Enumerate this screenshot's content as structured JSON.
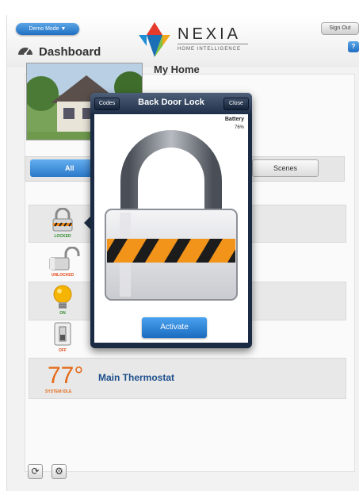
{
  "header": {
    "demo_mode_label": "Demo Mode ▼",
    "page_title": "Dashboard",
    "logo_name": "NEXIA",
    "logo_tagline": "HOME INTELLIGENCE",
    "sign_out_label": "Sign Out",
    "help_label": "?"
  },
  "home": {
    "title": "My Home"
  },
  "tabs": {
    "all_devices_label": "All Devices",
    "scenes_label": "Scenes"
  },
  "devices": [
    {
      "status": "LOCKED",
      "status_color": "#2d8a2d",
      "icon": "padlock-locked-icon"
    },
    {
      "status": "UNLOCKED",
      "status_color": "#e24a1a",
      "icon": "padlock-unlocked-icon"
    },
    {
      "status": "ON",
      "status_color": "#2d8a2d",
      "icon": "light-bulb-icon"
    },
    {
      "status": "OFF",
      "status_color": "#e24a1a",
      "icon": "light-switch-icon"
    }
  ],
  "thermostat": {
    "temperature": "77°",
    "status": "SYSTEM IDLE",
    "name": "Main Thermostat"
  },
  "footer": {
    "refresh_icon": "refresh-icon",
    "settings_icon": "gear-icon"
  },
  "modal": {
    "title": "Back Door Lock",
    "codes_label": "Codes",
    "close_label": "Close",
    "battery_label": "Battery",
    "battery_value": "76%",
    "activate_label": "Activate"
  },
  "colors": {
    "accent_blue": "#2a78c9",
    "modal_dark": "#1b2b44",
    "thermostat_orange": "#e46b1a"
  }
}
